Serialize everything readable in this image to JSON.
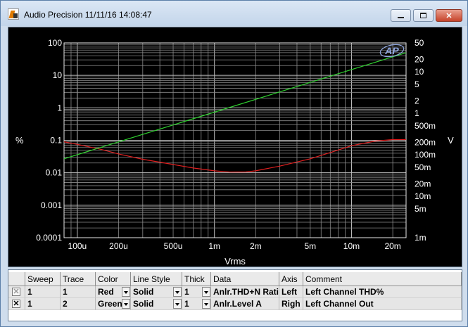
{
  "window": {
    "title": "Audio Precision  11/11/16 14:08:47",
    "icon": "audio-precision-logo",
    "controls": {
      "minimize": "minimize-icon",
      "maximize": "maximize-icon",
      "close": "✕"
    }
  },
  "chart_data": {
    "type": "line",
    "xlabel": "Vrms",
    "ylabel_left": "%",
    "ylabel_right": "V",
    "x_scale": "log",
    "y_scale": "log",
    "grid": true,
    "xlim": [
      8e-05,
      0.025
    ],
    "ylim_left": [
      0.0001,
      100
    ],
    "ylim_right": [
      0.001,
      50
    ],
    "x_ticks": [
      {
        "v": 0.0001,
        "label": "100u"
      },
      {
        "v": 0.0002,
        "label": "200u"
      },
      {
        "v": 0.0005,
        "label": "500u"
      },
      {
        "v": 0.001,
        "label": "1m"
      },
      {
        "v": 0.002,
        "label": "2m"
      },
      {
        "v": 0.005,
        "label": "5m"
      },
      {
        "v": 0.01,
        "label": "10m"
      },
      {
        "v": 0.02,
        "label": "20m"
      }
    ],
    "y_left_ticks": [
      {
        "v": 100,
        "label": "100"
      },
      {
        "v": 10,
        "label": "10"
      },
      {
        "v": 1,
        "label": "1"
      },
      {
        "v": 0.1,
        "label": "0.1"
      },
      {
        "v": 0.01,
        "label": "0.01"
      },
      {
        "v": 0.001,
        "label": "0.001"
      },
      {
        "v": 0.0001,
        "label": "0.0001"
      }
    ],
    "y_right_ticks": [
      {
        "v": 50,
        "label": "50"
      },
      {
        "v": 20,
        "label": "20"
      },
      {
        "v": 10,
        "label": "10"
      },
      {
        "v": 5,
        "label": "5"
      },
      {
        "v": 2,
        "label": "2"
      },
      {
        "v": 1,
        "label": "1"
      },
      {
        "v": 0.5,
        "label": "500m"
      },
      {
        "v": 0.2,
        "label": "200m"
      },
      {
        "v": 0.1,
        "label": "100m"
      },
      {
        "v": 0.05,
        "label": "50m"
      },
      {
        "v": 0.02,
        "label": "20m"
      },
      {
        "v": 0.01,
        "label": "10m"
      },
      {
        "v": 0.005,
        "label": "5m"
      },
      {
        "v": 0.001,
        "label": "1m"
      }
    ],
    "series": [
      {
        "axis": "left",
        "color": "#e02020",
        "x": [
          8e-05,
          0.0001,
          0.00015,
          0.0002,
          0.0003,
          0.0005,
          0.0007,
          0.001,
          0.0013,
          0.0017,
          0.002,
          0.003,
          0.005,
          0.007,
          0.01,
          0.015,
          0.02,
          0.025
        ],
        "y": [
          0.09,
          0.075,
          0.052,
          0.038,
          0.026,
          0.018,
          0.014,
          0.0115,
          0.0105,
          0.0106,
          0.0115,
          0.016,
          0.027,
          0.042,
          0.068,
          0.095,
          0.105,
          0.105
        ]
      },
      {
        "axis": "right",
        "color": "#2fd02f",
        "x": [
          8e-05,
          0.025
        ],
        "y": [
          0.08,
          29
        ]
      }
    ],
    "logo_text": "AP"
  },
  "trace_table": {
    "headers": [
      "Sweep",
      "Trace",
      "Color",
      "Line Style",
      "Thick",
      "Data",
      "Axis",
      "Comment"
    ],
    "rows": [
      {
        "checked": "✕",
        "sweep": "1",
        "trace": "1",
        "color": "Red",
        "style": "Solid",
        "thick": "1",
        "data": "Anlr.THD+N Ratio",
        "axis": "Left",
        "comment": "Left Channel THD%"
      },
      {
        "checked": "✕",
        "sweep": "1",
        "trace": "2",
        "color": "Green",
        "style": "Solid",
        "thick": "1",
        "data": "Anlr.Level A",
        "axis": "Righ",
        "comment": "Left Channel Out"
      }
    ]
  }
}
